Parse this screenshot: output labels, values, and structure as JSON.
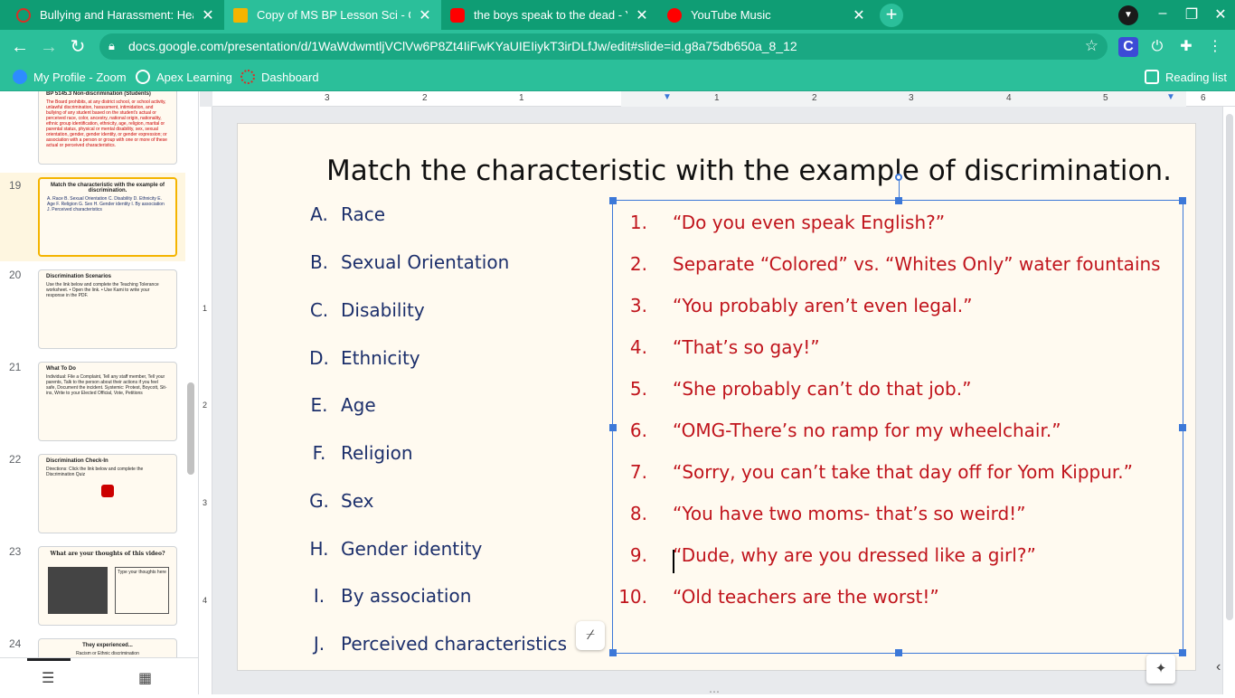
{
  "browser": {
    "tabs": [
      {
        "title": "Bullying and Harassment: Healt",
        "close": "✕",
        "fav_color": "#d93025"
      },
      {
        "title": "Copy of MS BP Lesson Sci - Goo",
        "close": "✕",
        "fav_color": "#f4b400"
      },
      {
        "title": "the boys speak to the dead - You",
        "close": "✕",
        "fav_color": "#ff0000"
      },
      {
        "title": "YouTube Music",
        "close": "✕",
        "fav_color": "#ff0000"
      }
    ],
    "new_tab": "+",
    "url": "docs.google.com/presentation/d/1WaWdwmtljVClVw6P8Zt4IiFwKYaUIEIiykT3irDLfJw/edit#slide=id.g8a75db650a_8_12",
    "bookmarks": [
      {
        "label": "My Profile - Zoom",
        "color": "#2d8cff"
      },
      {
        "label": "Apex Learning",
        "color": "#ffffff"
      },
      {
        "label": "Dashboard",
        "color": "#d93025"
      }
    ],
    "reading_list": "Reading list"
  },
  "filmstrip": {
    "slides": [
      {
        "number": "",
        "title": "BP 5145.3 Non-discrimination (Students)",
        "body": "The Board prohibits, at any district school, or school activity, unlawful discrimination, harassment, intimidation, and bullying of any student based on the student's actual or perceived race, color, ancestry, national origin, nationality, ethnic group identification, ethnicity, age, religion, marital or parental status, physical or mental disability, sex, sexual orientation, gender, gender identity, or gender expression; or association with a person or group with one or more of these actual or perceived characteristics."
      },
      {
        "number": "19",
        "title": "Match the characteristic with the example of discrimination.",
        "body": "A. Race  B. Sexual Orientation  C. Disability  D. Ethnicity  E. Age  F. Religion  G. Sex  H. Gender identity  I. By association  J. Perceived characteristics"
      },
      {
        "number": "20",
        "title": "Discrimination Scenarios",
        "body": "Use the link below and complete the Teaching Tolerance worksheet. • Open the link. • Use Kami to write your response in the PDF."
      },
      {
        "number": "21",
        "title": "What To Do",
        "body": "Individual: File a Complaint, Tell any staff member, Tell your parents, Talk to the person about their actions if you feel safe, Document the incident. Systemic: Protest, Boycott, Sit-ins, Write to your Elected Official, Vote, Petitions"
      },
      {
        "number": "22",
        "title": "Discrimination Check-In",
        "body": "Directions: Click the link below and complete the Discrimination Quiz"
      },
      {
        "number": "23",
        "title": "What are your thoughts of this video?",
        "body": "Type your thoughts here"
      },
      {
        "number": "24",
        "title": "They experienced...",
        "body": "Racism or Ethnic discrimination"
      }
    ]
  },
  "ruler": {
    "h": [
      "3",
      "2",
      "1",
      "1",
      "2",
      "3",
      "4",
      "5",
      "6"
    ],
    "v": [
      "1",
      "2",
      "3",
      "4"
    ]
  },
  "slide": {
    "title": "Match the characteristic with the example of discrimination.",
    "characteristics": [
      {
        "letter": "A.",
        "text": "Race"
      },
      {
        "letter": "B.",
        "text": "Sexual Orientation"
      },
      {
        "letter": "C.",
        "text": "Disability"
      },
      {
        "letter": "D.",
        "text": "Ethnicity"
      },
      {
        "letter": "E.",
        "text": "Age"
      },
      {
        "letter": "F.",
        "text": "Religion"
      },
      {
        "letter": "G.",
        "text": "Sex"
      },
      {
        "letter": "H.",
        "text": "Gender identity"
      },
      {
        "letter": "I.",
        "text": "By association"
      },
      {
        "letter": "J.",
        "text": "Perceived characteristics"
      }
    ],
    "examples": [
      {
        "num": "1.",
        "text": "“Do you even speak English?”"
      },
      {
        "num": "2.",
        "text": "Separate “Colored” vs. “Whites Only” water fountains"
      },
      {
        "num": "3.",
        "text": "“You probably aren’t even legal.”"
      },
      {
        "num": "4.",
        "text": "“That’s so gay!”"
      },
      {
        "num": "5.",
        "text": "“She probably can’t do that job.”"
      },
      {
        "num": "6.",
        "text": "“OMG-There’s no ramp for my wheelchair.”"
      },
      {
        "num": "7.",
        "text": "“Sorry, you can’t take that day off for Yom Kippur.”"
      },
      {
        "num": "8.",
        "text": "“You have two moms- that’s so weird!”"
      },
      {
        "num": "9.",
        "text": "“Dude, why are you dressed like a girl?”"
      },
      {
        "num": "10.",
        "text": "“Old teachers are the worst!”"
      }
    ]
  },
  "colors": {
    "chrome": "#2bbf9a",
    "tabstrip": "#0f9d74",
    "left_text": "#1c2f6b",
    "right_text": "#c0141c",
    "selection": "#3c78d8"
  }
}
